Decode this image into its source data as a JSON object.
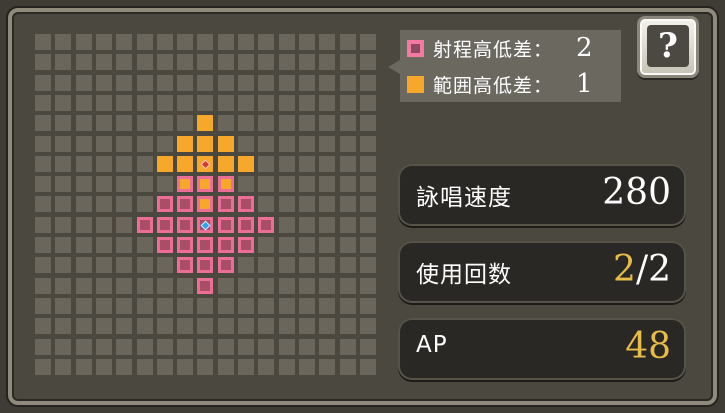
{
  "legend": {
    "range_height_label": "射程高低差：",
    "range_height_value": "2",
    "area_height_label": "範囲高低差：",
    "area_height_value": "1"
  },
  "help": {
    "icon_text": "?"
  },
  "stats": {
    "cast_speed_label": "詠唱速度",
    "cast_speed_value": "280",
    "uses_label": "使用回数",
    "uses_current": "2",
    "uses_separator": "/",
    "uses_max": "2",
    "ap_label": "AP",
    "ap_value": "48"
  },
  "grid": {
    "size": 17,
    "cells": [
      {
        "c": 8,
        "r": 4,
        "t": "orange"
      },
      {
        "c": 7,
        "r": 5,
        "t": "orange"
      },
      {
        "c": 8,
        "r": 5,
        "t": "orange"
      },
      {
        "c": 9,
        "r": 5,
        "t": "orange"
      },
      {
        "c": 6,
        "r": 6,
        "t": "orange"
      },
      {
        "c": 7,
        "r": 6,
        "t": "orange"
      },
      {
        "c": 8,
        "r": 6,
        "t": "target"
      },
      {
        "c": 9,
        "r": 6,
        "t": "orange"
      },
      {
        "c": 10,
        "r": 6,
        "t": "orange"
      },
      {
        "c": 7,
        "r": 7,
        "t": "pink-orange"
      },
      {
        "c": 8,
        "r": 7,
        "t": "pink-orange"
      },
      {
        "c": 9,
        "r": 7,
        "t": "pink-orange"
      },
      {
        "c": 6,
        "r": 8,
        "t": "pink"
      },
      {
        "c": 7,
        "r": 8,
        "t": "pink"
      },
      {
        "c": 8,
        "r": 8,
        "t": "pink-orange"
      },
      {
        "c": 9,
        "r": 8,
        "t": "pink"
      },
      {
        "c": 10,
        "r": 8,
        "t": "pink"
      },
      {
        "c": 5,
        "r": 9,
        "t": "pink"
      },
      {
        "c": 6,
        "r": 9,
        "t": "pink"
      },
      {
        "c": 7,
        "r": 9,
        "t": "pink"
      },
      {
        "c": 8,
        "r": 9,
        "t": "caster"
      },
      {
        "c": 9,
        "r": 9,
        "t": "pink"
      },
      {
        "c": 10,
        "r": 9,
        "t": "pink"
      },
      {
        "c": 11,
        "r": 9,
        "t": "pink"
      },
      {
        "c": 6,
        "r": 10,
        "t": "pink"
      },
      {
        "c": 7,
        "r": 10,
        "t": "pink"
      },
      {
        "c": 8,
        "r": 10,
        "t": "pink"
      },
      {
        "c": 9,
        "r": 10,
        "t": "pink"
      },
      {
        "c": 10,
        "r": 10,
        "t": "pink"
      },
      {
        "c": 7,
        "r": 11,
        "t": "pink"
      },
      {
        "c": 8,
        "r": 11,
        "t": "pink"
      },
      {
        "c": 9,
        "r": 11,
        "t": "pink"
      },
      {
        "c": 8,
        "r": 12,
        "t": "pink"
      }
    ]
  }
}
